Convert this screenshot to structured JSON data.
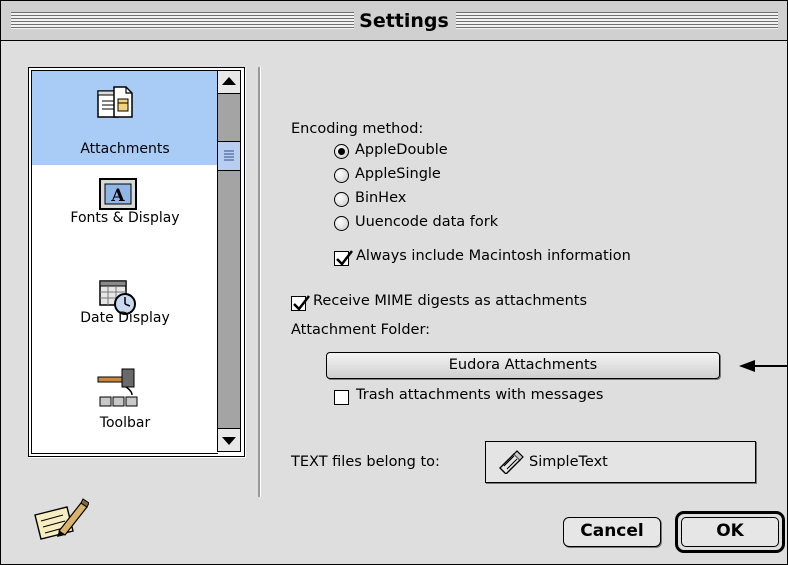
{
  "window": {
    "title": "Settings"
  },
  "categories": [
    {
      "label": "Attachments",
      "icon": "attachments-icon",
      "selected": true
    },
    {
      "label": "Fonts & Display",
      "icon": "fonts-display-icon",
      "selected": false
    },
    {
      "label": "Date Display",
      "icon": "date-display-icon",
      "selected": false
    },
    {
      "label": "Toolbar",
      "icon": "toolbar-icon",
      "selected": false
    }
  ],
  "encoding": {
    "label": "Encoding method:",
    "options": [
      {
        "label": "AppleDouble",
        "selected": true
      },
      {
        "label": "AppleSingle",
        "selected": false
      },
      {
        "label": "BinHex",
        "selected": false
      },
      {
        "label": "Uuencode data fork",
        "selected": false
      }
    ],
    "always_include": {
      "label": "Always include Macintosh information",
      "checked": true
    }
  },
  "mime_digests": {
    "label": "Receive MIME digests as attachments",
    "checked": true
  },
  "attachment_folder": {
    "label": "Attachment Folder:",
    "button_label": "Eudora Attachments"
  },
  "trash_attachments": {
    "label": "Trash attachments with messages",
    "checked": false
  },
  "text_files": {
    "label": "TEXT files belong to:",
    "app": "SimpleText"
  },
  "buttons": {
    "cancel": "Cancel",
    "ok": "OK"
  },
  "colors": {
    "selection": "#a8ccf6",
    "scroll_thumb": "#b8cef0",
    "window_bg": "#dedede"
  }
}
